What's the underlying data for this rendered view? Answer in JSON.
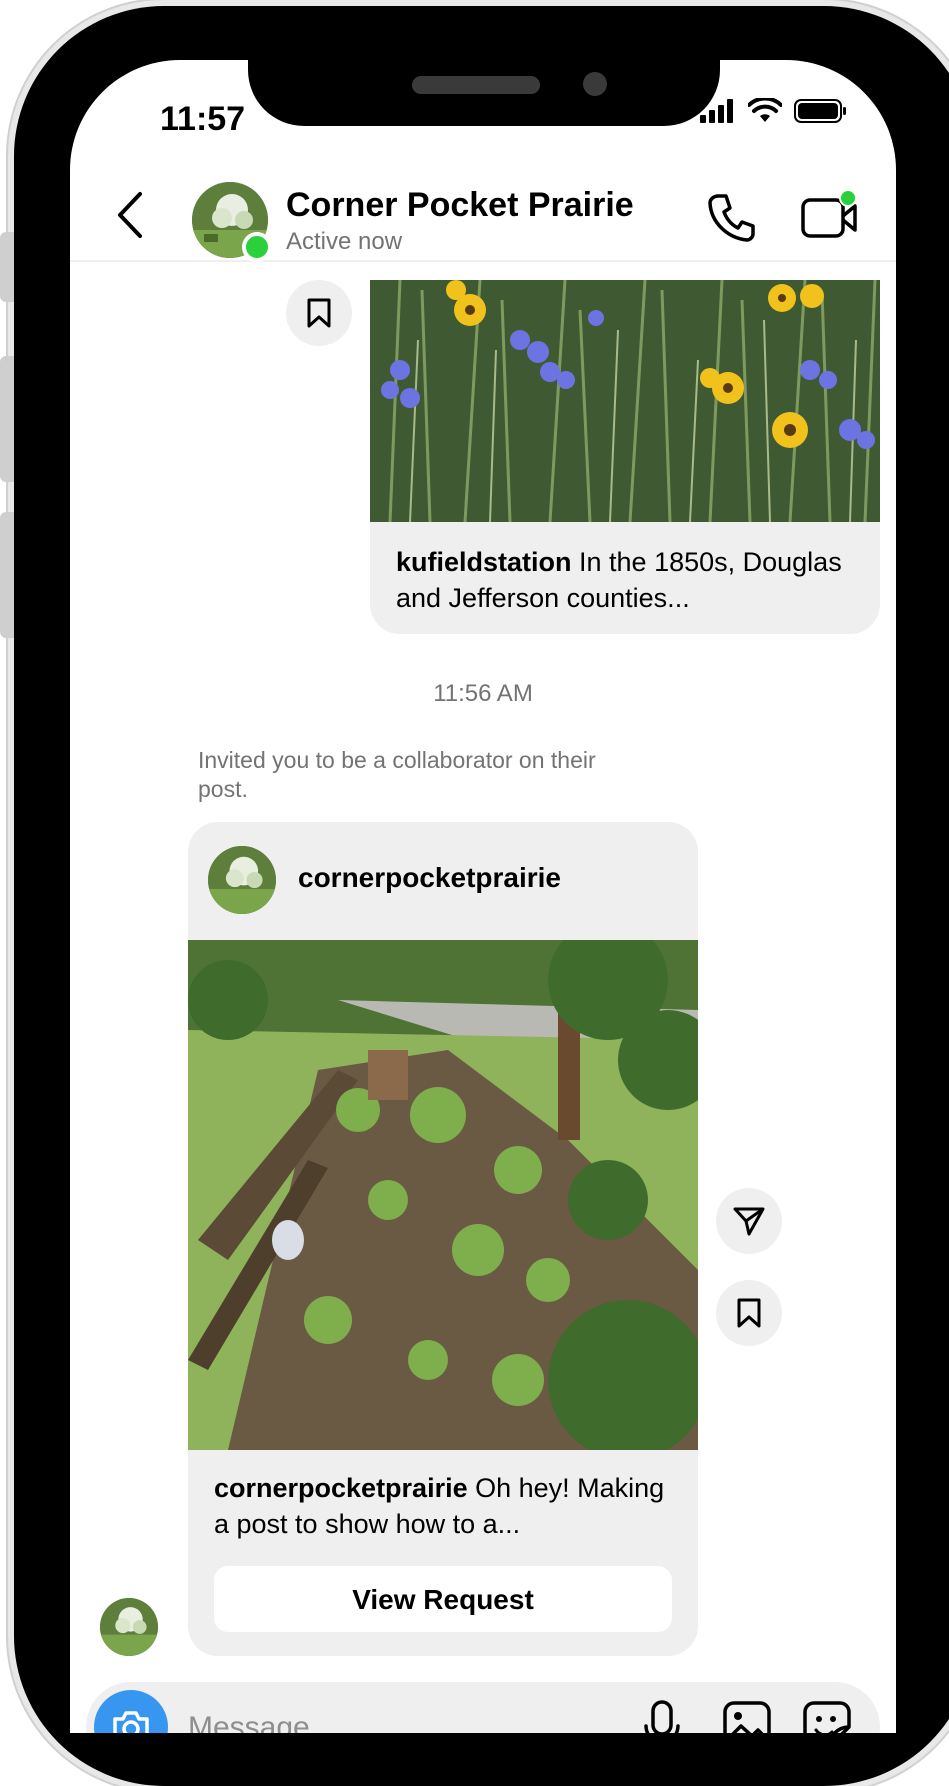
{
  "status_bar": {
    "time": "11:57"
  },
  "header": {
    "name": "Corner Pocket Prairie",
    "status": "Active now"
  },
  "shared_post": {
    "username": "kufieldstation",
    "caption": " In the 1850s, Douglas and Jefferson counties..."
  },
  "thread": {
    "timestamp": "11:56 AM",
    "invite_note": "Invited you to be a collaborator on their post."
  },
  "collab_post": {
    "author": "cornerpocketprairie",
    "caption_user": "cornerpocketprairie",
    "caption": " Oh hey! Making a post to show how to a...",
    "view_request_label": "View Request"
  },
  "composer": {
    "placeholder": "Message..."
  },
  "colors": {
    "online": "#2bd13a",
    "camera_button": "#3797f0",
    "bubble": "#efefef",
    "secondary_text": "#737373"
  },
  "icons": {
    "back": "chevron-left-icon",
    "call": "phone-icon",
    "video": "video-camera-icon",
    "save": "bookmark-icon",
    "share": "paper-plane-icon",
    "camera": "camera-icon",
    "mic": "microphone-icon",
    "gallery": "image-icon",
    "sticker": "sticker-icon"
  }
}
